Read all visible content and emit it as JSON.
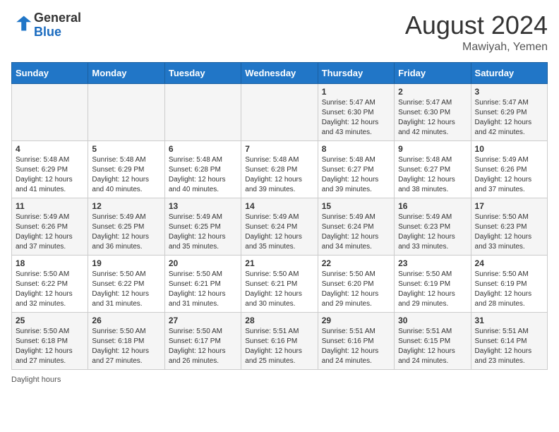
{
  "header": {
    "logo_general": "General",
    "logo_blue": "Blue",
    "month_year": "August 2024",
    "location": "Mawiyah, Yemen"
  },
  "days_of_week": [
    "Sunday",
    "Monday",
    "Tuesday",
    "Wednesday",
    "Thursday",
    "Friday",
    "Saturday"
  ],
  "weeks": [
    [
      {
        "day": "",
        "info": ""
      },
      {
        "day": "",
        "info": ""
      },
      {
        "day": "",
        "info": ""
      },
      {
        "day": "",
        "info": ""
      },
      {
        "day": "1",
        "info": "Sunrise: 5:47 AM\nSunset: 6:30 PM\nDaylight: 12 hours\nand 43 minutes."
      },
      {
        "day": "2",
        "info": "Sunrise: 5:47 AM\nSunset: 6:30 PM\nDaylight: 12 hours\nand 42 minutes."
      },
      {
        "day": "3",
        "info": "Sunrise: 5:47 AM\nSunset: 6:29 PM\nDaylight: 12 hours\nand 42 minutes."
      }
    ],
    [
      {
        "day": "4",
        "info": "Sunrise: 5:48 AM\nSunset: 6:29 PM\nDaylight: 12 hours\nand 41 minutes."
      },
      {
        "day": "5",
        "info": "Sunrise: 5:48 AM\nSunset: 6:29 PM\nDaylight: 12 hours\nand 40 minutes."
      },
      {
        "day": "6",
        "info": "Sunrise: 5:48 AM\nSunset: 6:28 PM\nDaylight: 12 hours\nand 40 minutes."
      },
      {
        "day": "7",
        "info": "Sunrise: 5:48 AM\nSunset: 6:28 PM\nDaylight: 12 hours\nand 39 minutes."
      },
      {
        "day": "8",
        "info": "Sunrise: 5:48 AM\nSunset: 6:27 PM\nDaylight: 12 hours\nand 39 minutes."
      },
      {
        "day": "9",
        "info": "Sunrise: 5:48 AM\nSunset: 6:27 PM\nDaylight: 12 hours\nand 38 minutes."
      },
      {
        "day": "10",
        "info": "Sunrise: 5:49 AM\nSunset: 6:26 PM\nDaylight: 12 hours\nand 37 minutes."
      }
    ],
    [
      {
        "day": "11",
        "info": "Sunrise: 5:49 AM\nSunset: 6:26 PM\nDaylight: 12 hours\nand 37 minutes."
      },
      {
        "day": "12",
        "info": "Sunrise: 5:49 AM\nSunset: 6:25 PM\nDaylight: 12 hours\nand 36 minutes."
      },
      {
        "day": "13",
        "info": "Sunrise: 5:49 AM\nSunset: 6:25 PM\nDaylight: 12 hours\nand 35 minutes."
      },
      {
        "day": "14",
        "info": "Sunrise: 5:49 AM\nSunset: 6:24 PM\nDaylight: 12 hours\nand 35 minutes."
      },
      {
        "day": "15",
        "info": "Sunrise: 5:49 AM\nSunset: 6:24 PM\nDaylight: 12 hours\nand 34 minutes."
      },
      {
        "day": "16",
        "info": "Sunrise: 5:49 AM\nSunset: 6:23 PM\nDaylight: 12 hours\nand 33 minutes."
      },
      {
        "day": "17",
        "info": "Sunrise: 5:50 AM\nSunset: 6:23 PM\nDaylight: 12 hours\nand 33 minutes."
      }
    ],
    [
      {
        "day": "18",
        "info": "Sunrise: 5:50 AM\nSunset: 6:22 PM\nDaylight: 12 hours\nand 32 minutes."
      },
      {
        "day": "19",
        "info": "Sunrise: 5:50 AM\nSunset: 6:22 PM\nDaylight: 12 hours\nand 31 minutes."
      },
      {
        "day": "20",
        "info": "Sunrise: 5:50 AM\nSunset: 6:21 PM\nDaylight: 12 hours\nand 31 minutes."
      },
      {
        "day": "21",
        "info": "Sunrise: 5:50 AM\nSunset: 6:21 PM\nDaylight: 12 hours\nand 30 minutes."
      },
      {
        "day": "22",
        "info": "Sunrise: 5:50 AM\nSunset: 6:20 PM\nDaylight: 12 hours\nand 29 minutes."
      },
      {
        "day": "23",
        "info": "Sunrise: 5:50 AM\nSunset: 6:19 PM\nDaylight: 12 hours\nand 29 minutes."
      },
      {
        "day": "24",
        "info": "Sunrise: 5:50 AM\nSunset: 6:19 PM\nDaylight: 12 hours\nand 28 minutes."
      }
    ],
    [
      {
        "day": "25",
        "info": "Sunrise: 5:50 AM\nSunset: 6:18 PM\nDaylight: 12 hours\nand 27 minutes."
      },
      {
        "day": "26",
        "info": "Sunrise: 5:50 AM\nSunset: 6:18 PM\nDaylight: 12 hours\nand 27 minutes."
      },
      {
        "day": "27",
        "info": "Sunrise: 5:50 AM\nSunset: 6:17 PM\nDaylight: 12 hours\nand 26 minutes."
      },
      {
        "day": "28",
        "info": "Sunrise: 5:51 AM\nSunset: 6:16 PM\nDaylight: 12 hours\nand 25 minutes."
      },
      {
        "day": "29",
        "info": "Sunrise: 5:51 AM\nSunset: 6:16 PM\nDaylight: 12 hours\nand 24 minutes."
      },
      {
        "day": "30",
        "info": "Sunrise: 5:51 AM\nSunset: 6:15 PM\nDaylight: 12 hours\nand 24 minutes."
      },
      {
        "day": "31",
        "info": "Sunrise: 5:51 AM\nSunset: 6:14 PM\nDaylight: 12 hours\nand 23 minutes."
      }
    ]
  ],
  "footer": {
    "daylight_label": "Daylight hours"
  }
}
